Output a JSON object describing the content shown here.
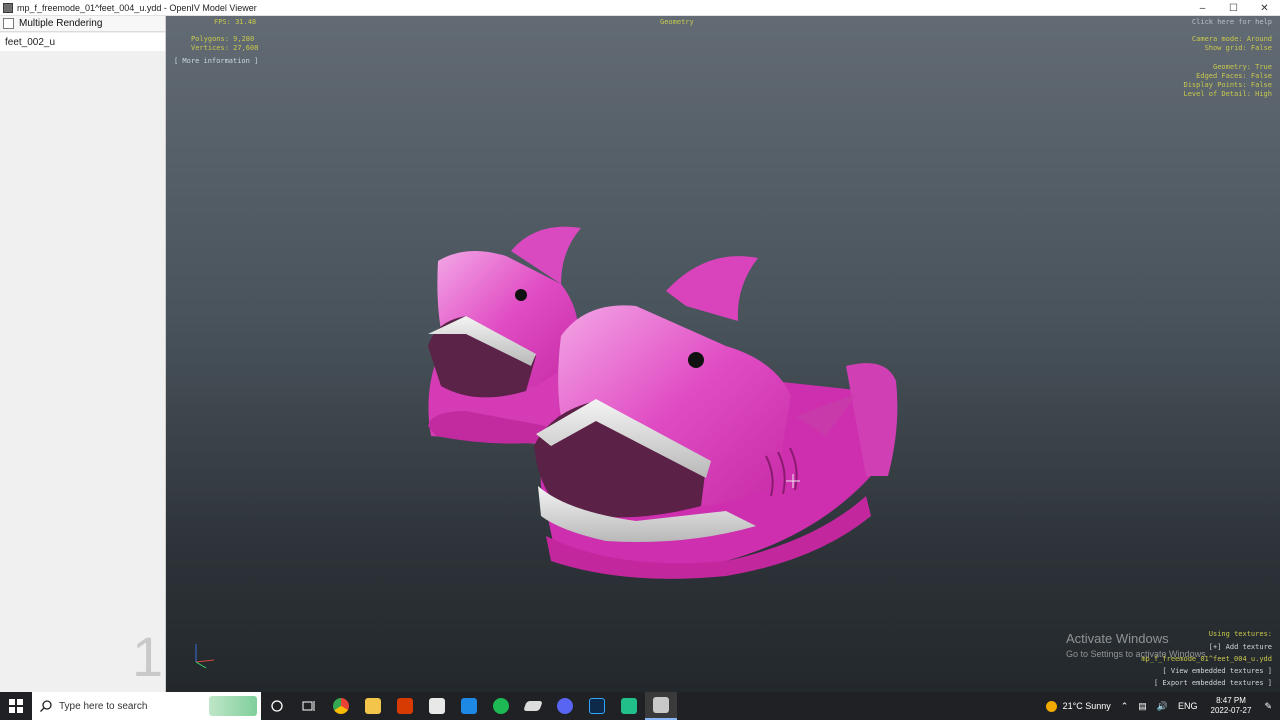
{
  "window": {
    "title": "mp_f_freemode_01^feet_004_u.ydd - OpenIV Model Viewer",
    "controls": [
      "–",
      "☐",
      "✕"
    ]
  },
  "sidebar": {
    "multiple_rendering_label": "Multiple Rendering",
    "items": [
      {
        "label": "feet_002_u"
      }
    ],
    "page_number": "1"
  },
  "hud": {
    "fps": "FPS: 31.48",
    "polygons": "Polygons: 9,280",
    "vertices": "Vertices: 27,608",
    "more_info": "[ More information ]",
    "geometry_tab": "Geometry",
    "help": "Click here for help",
    "camera_mode": "Camera mode: Around",
    "show_grid": "Show grid: False",
    "geometry": "Geometry: True",
    "edged_faces": "Edged Faces: False",
    "display_points": "Display Points: False",
    "level_of_detail": "Level of Detail: High",
    "using_textures": "Using textures:",
    "add_texture": "[+] Add texture",
    "texture_file": "mp_f_freemode_01^feet_004_u.ydd",
    "view_embedded": "[ View embedded textures ]",
    "export_embedded": "[ Export embedded textures ]"
  },
  "watermark": {
    "line1": "Activate Windows",
    "line2": "Go to Settings to activate Windows."
  },
  "taskbar": {
    "search_placeholder": "Type here to search",
    "apps": [
      "cortana-icon",
      "task-view-icon",
      "chrome-icon",
      "file-explorer-icon",
      "office-icon",
      "store-icon",
      "mail-icon",
      "spotify-icon",
      "app-icon",
      "discord-icon",
      "photoshop-icon",
      "app-icon-2",
      "openiv-icon"
    ],
    "weather": "21°C  Sunny",
    "language": "ENG",
    "time": "8:47 PM",
    "date": "2022-07-27"
  },
  "colors": {
    "viewport_top": "#626b74",
    "viewport_bottom": "#23282c",
    "hud_yellow": "#c9c84c",
    "shark_pink": "#e23fbf",
    "taskbar": "#202124"
  }
}
